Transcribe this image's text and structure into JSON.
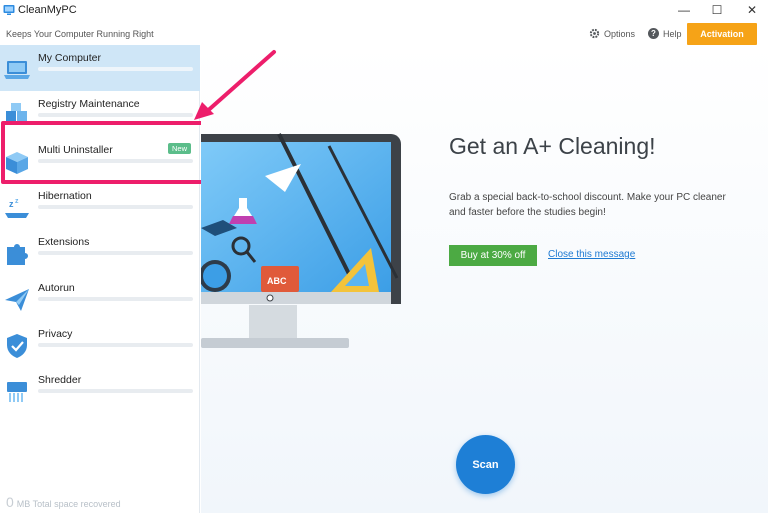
{
  "app": {
    "title": "CleanMyPC",
    "tagline": "Keeps Your Computer Running Right"
  },
  "window": {
    "minimize": "—",
    "maximize": "☐",
    "close": "✕"
  },
  "header": {
    "options_label": "Options",
    "help_label": "Help",
    "activation_label": "Activation"
  },
  "sidebar": {
    "items": [
      {
        "label": "My Computer",
        "icon": "laptop-icon"
      },
      {
        "label": "Registry Maintenance",
        "icon": "registry-cubes-icon"
      },
      {
        "label": "Multi Uninstaller",
        "icon": "box-icon",
        "badge": "New"
      },
      {
        "label": "Hibernation",
        "icon": "sleep-icon"
      },
      {
        "label": "Extensions",
        "icon": "puzzle-icon"
      },
      {
        "label": "Autorun",
        "icon": "paper-plane-icon"
      },
      {
        "label": "Privacy",
        "icon": "shield-icon"
      },
      {
        "label": "Shredder",
        "icon": "shredder-icon"
      }
    ],
    "space_value": "0",
    "space_text": "MB Total space recovered"
  },
  "promo": {
    "headline": "Get an A+ Cleaning!",
    "text": "Grab a special back-to-school discount. Make your PC cleaner and faster before the studies begin!",
    "buy_label": "Buy at 30% off",
    "close_label": "Close this message",
    "monitor_book_text": "ABC"
  },
  "scan_label": "Scan",
  "colors": {
    "accent": "#1e7fd6",
    "activation": "#f6a317",
    "buy": "#4caa43",
    "highlight": "#ed1e6b",
    "badge": "#5bbd8a"
  }
}
